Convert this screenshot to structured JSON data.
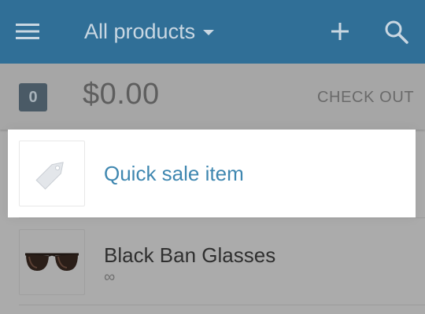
{
  "header": {
    "title": "All products",
    "menu_icon": "menu-icon",
    "add_icon": "plus-icon",
    "search_icon": "search-icon",
    "bar_color": "#306f97"
  },
  "cart": {
    "item_count": "0",
    "total": "$0.00",
    "checkout_label": "CHECK OUT"
  },
  "products": [
    {
      "name": "Quick sale item",
      "icon": "price-tag-icon"
    },
    {
      "name": "Black Ban Glasses",
      "stock": "∞",
      "icon": "sunglasses-icon"
    }
  ]
}
